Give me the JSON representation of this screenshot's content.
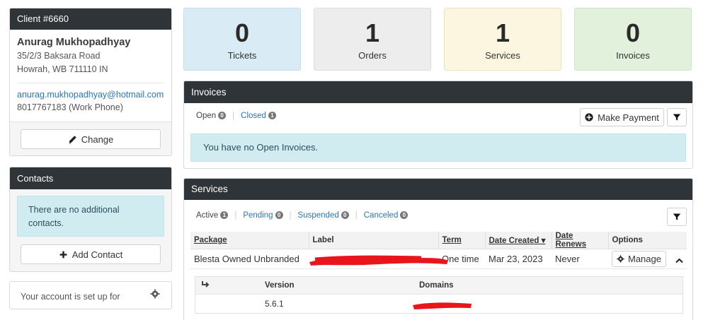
{
  "client": {
    "header": "Client #6660",
    "name": "Anurag Mukhopadhyay",
    "address_line1": "35/2/3 Baksara Road",
    "address_line2": "Howrah, WB 711110 IN",
    "email": "anurag.mukhopadhyay@hotmail.com",
    "phone": "8017767183 (Work Phone)",
    "change_label": "Change"
  },
  "contacts": {
    "header": "Contacts",
    "message": "There are no additional contacts.",
    "add_label": "Add Contact"
  },
  "notice": {
    "text": "Your account is set up for"
  },
  "stats": [
    {
      "value": "0",
      "label": "Tickets"
    },
    {
      "value": "1",
      "label": "Orders"
    },
    {
      "value": "1",
      "label": "Services"
    },
    {
      "value": "0",
      "label": "Invoices"
    }
  ],
  "invoices": {
    "header": "Invoices",
    "filters": [
      {
        "label": "Open",
        "count": "0"
      },
      {
        "label": "Closed",
        "count": "1"
      }
    ],
    "make_payment_label": "Make Payment",
    "empty_message": "You have no Open Invoices."
  },
  "services": {
    "header": "Services",
    "filters": [
      {
        "label": "Active",
        "count": "1"
      },
      {
        "label": "Pending",
        "count": "0"
      },
      {
        "label": "Suspended",
        "count": "0"
      },
      {
        "label": "Canceled",
        "count": "0"
      }
    ],
    "columns": [
      "Package",
      "Label",
      "Term",
      "Date Created",
      "Date Renews",
      "Options"
    ],
    "sort_indicator": "▾",
    "row": {
      "package": "Blesta Owned Unbranded",
      "term": "One time",
      "date_created": "Mar 23, 2023",
      "date_renews": "Never",
      "manage_label": "Manage"
    },
    "sub_columns": [
      "Version",
      "Domains"
    ],
    "sub_row": {
      "version": "5.6.1"
    }
  },
  "colors": {
    "dark_header": "#2f3438",
    "link": "#2a75b8",
    "info_bg": "#d1ecf1",
    "tickets_bg": "#d9ecf5",
    "orders_bg": "#ededed",
    "services_bg": "#fcf6e1",
    "invoices_bg": "#e1f1dc",
    "redaction": "#e8161b"
  }
}
